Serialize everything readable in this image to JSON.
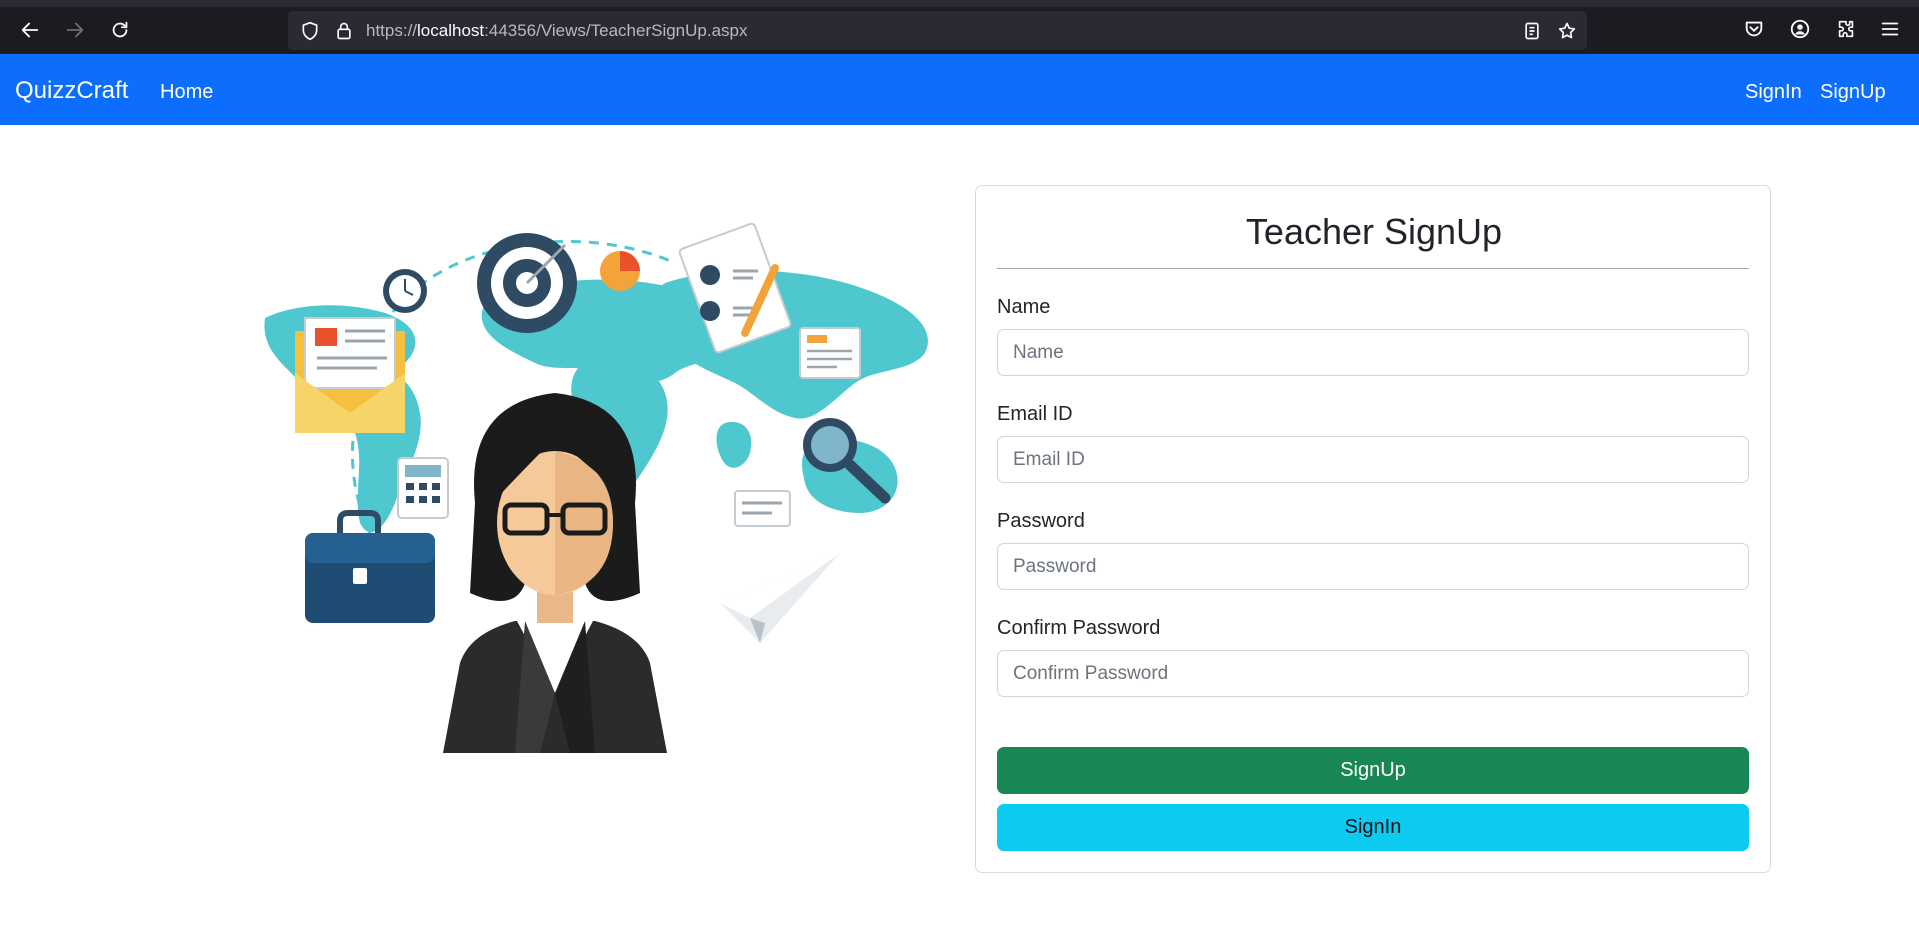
{
  "browser": {
    "url_prefix": "https://",
    "url_host": "localhost",
    "url_rest": ":44356/Views/TeacherSignUp.aspx"
  },
  "navbar": {
    "brand": "QuizzCraft",
    "home": "Home",
    "signin": "SignIn",
    "signup": "SignUp"
  },
  "form": {
    "title": "Teacher SignUp",
    "fields": [
      {
        "label": "Name",
        "placeholder": "Name"
      },
      {
        "label": "Email ID",
        "placeholder": "Email ID"
      },
      {
        "label": "Password",
        "placeholder": "Password"
      },
      {
        "label": "Confirm Password",
        "placeholder": "Confirm Password"
      }
    ],
    "signup_button": "SignUp",
    "signin_button": "SignIn"
  },
  "colors": {
    "navbar": "#0d6efd",
    "signup_button": "#198754",
    "signin_button": "#0dcaf0"
  }
}
